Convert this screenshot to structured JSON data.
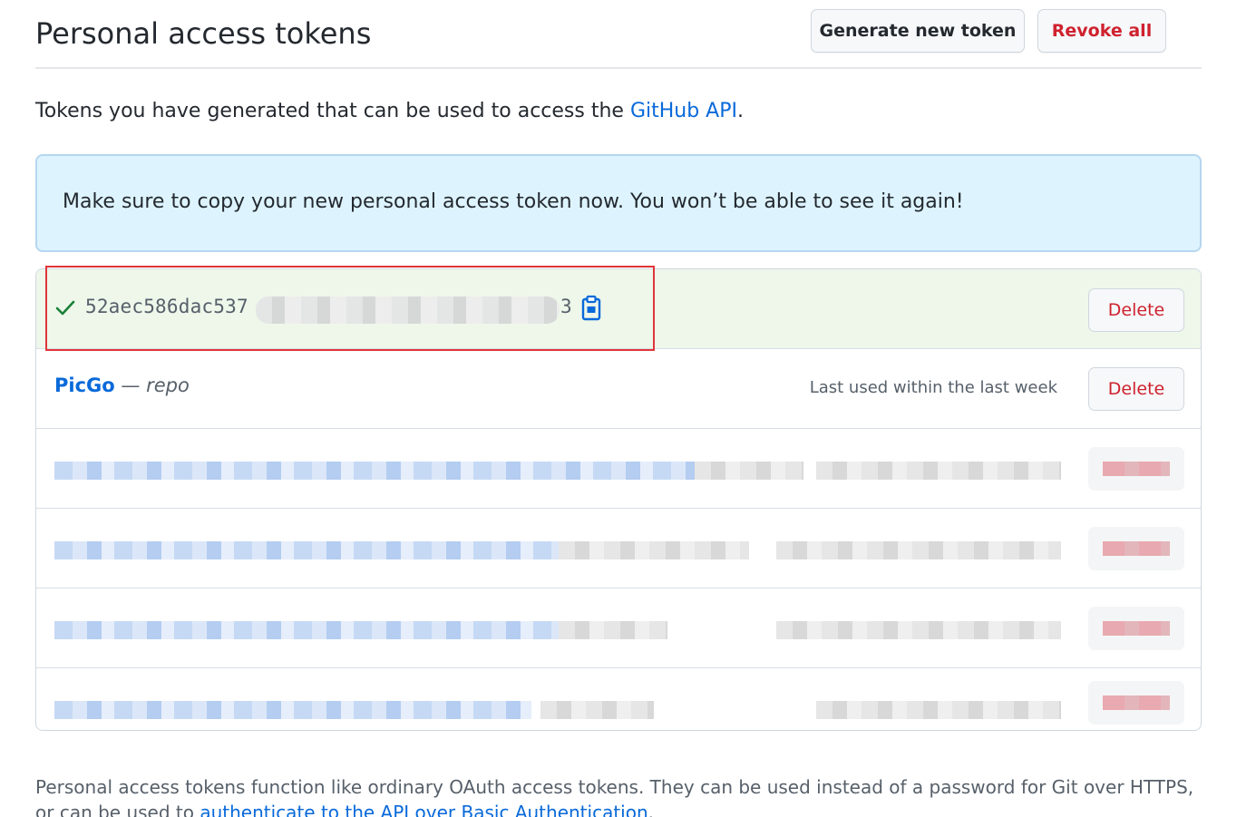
{
  "header": {
    "title": "Personal access tokens",
    "generate_label": "Generate new token",
    "revoke_label": "Revoke all"
  },
  "intro": {
    "text": "Tokens you have generated that can be used to access the ",
    "link": "GitHub API",
    "suffix": "."
  },
  "flash": {
    "message": "Make sure to copy your new personal access token now. You won’t be able to see it again!"
  },
  "new_token": {
    "prefix": "52aec586dac537",
    "suffix": "3",
    "delete_label": "Delete"
  },
  "tokens": [
    {
      "name": "PicGo",
      "separator": " — ",
      "scope": "repo",
      "last_used": "Last used within the last week",
      "delete_label": "Delete"
    }
  ],
  "footer": {
    "text": "Personal access tokens function like ordinary OAuth access tokens. They can be used instead of a password for Git over HTTPS, or can be used to ",
    "link": "authenticate to the API over Basic Authentication",
    "suffix": "."
  },
  "colors": {
    "accent": "#0969da",
    "danger": "#cf222e",
    "success": "#1a7f37",
    "flash_bg": "#ddf4ff",
    "new_token_bg": "#eef7ea",
    "highlight": "#e0353a"
  },
  "icons": {
    "check": "check-icon",
    "copy": "copy-icon"
  }
}
